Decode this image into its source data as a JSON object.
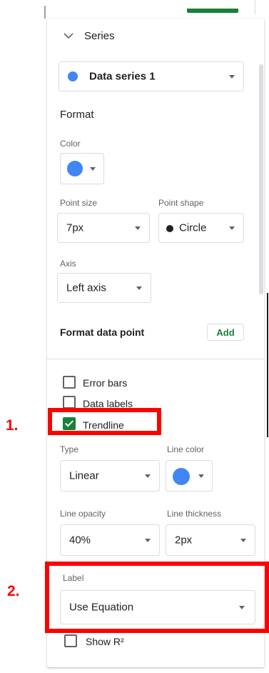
{
  "series_section": {
    "title": "Series"
  },
  "series_select": {
    "value": "Data series 1",
    "dot_color": "#4285f4"
  },
  "format": {
    "heading": "Format",
    "color_label": "Color",
    "color_value": "#4285f4",
    "point_size_label": "Point size",
    "point_size_value": "7px",
    "point_shape_label": "Point shape",
    "point_shape_value": "Circle",
    "axis_label": "Axis",
    "axis_value": "Left axis",
    "format_data_point_label": "Format data point",
    "add_button": "Add"
  },
  "checkboxes": {
    "error_bars": {
      "label": "Error bars",
      "checked": false
    },
    "data_labels": {
      "label": "Data labels",
      "checked": false
    },
    "trendline": {
      "label": "Trendline",
      "checked": true
    }
  },
  "trendline": {
    "type_label": "Type",
    "type_value": "Linear",
    "line_color_label": "Line color",
    "line_color_value": "#4285f4",
    "line_opacity_label": "Line opacity",
    "line_opacity_value": "40%",
    "line_thickness_label": "Line thickness",
    "line_thickness_value": "2px",
    "label_label": "Label",
    "label_value": "Use Equation",
    "show_r2": {
      "label": "Show R²",
      "checked": false
    }
  },
  "annotations": {
    "step1": "1.",
    "step2": "2.",
    "highlight_color": "#ff0000"
  },
  "colors": {
    "accent_green": "#188038",
    "series_blue": "#4285f4"
  }
}
